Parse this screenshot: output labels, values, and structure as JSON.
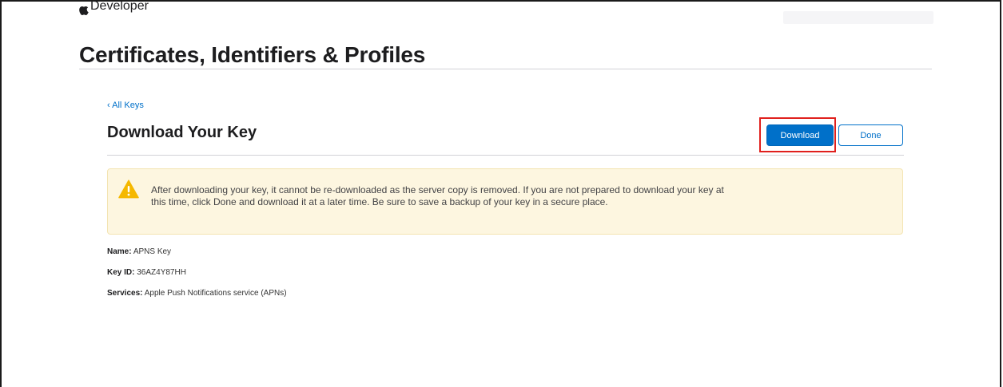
{
  "header": {
    "brand": "Developer",
    "icons": {
      "logo": "apple-logo-icon"
    }
  },
  "page": {
    "title": "Certificates, Identifiers & Profiles"
  },
  "section": {
    "back_link": "‹ All Keys",
    "title": "Download Your Key",
    "download_label": "Download",
    "done_label": "Done"
  },
  "alert": {
    "icon": "warning-icon",
    "message": "After downloading your key, it cannot be re-downloaded as the server copy is removed. If you are not prepared to download your key at this time, click Done and download it at a later time. Be sure to save a backup of your key in a secure place."
  },
  "details": {
    "name_label": "Name:",
    "name_value": "APNS Key",
    "keyid_label": "Key ID:",
    "keyid_value": "36AZ4Y87HH",
    "services_label": "Services:",
    "services_value": "Apple Push Notifications service (APNs)"
  },
  "colors": {
    "accent": "#0070c9",
    "highlight": "#e0201d",
    "alert_bg": "#fdf6e0",
    "warning": "#f5b800"
  }
}
